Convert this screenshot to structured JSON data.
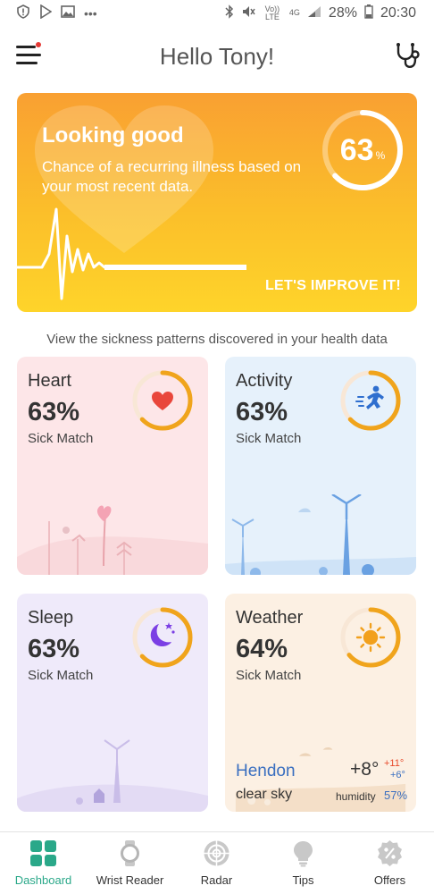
{
  "status_bar": {
    "battery": "28%",
    "time": "20:30",
    "volte_label": "Vo)) LTE",
    "network_label": "4G"
  },
  "header": {
    "title": "Hello Tony!"
  },
  "hero": {
    "title": "Looking good",
    "text": "Chance of a recurring illness based on your most recent data.",
    "percent_value": "63",
    "percent_symbol": "%",
    "progress": 0.63,
    "cta": "LET'S IMPROVE IT!"
  },
  "section_caption": "View the sickness patterns discovered in your health data",
  "cards": [
    {
      "title": "Heart",
      "percent": "63%",
      "subtitle": "Sick Match",
      "progress": 0.63,
      "icon": "heart-icon",
      "bg": "#fde6e8",
      "icon_color": "#e9463b"
    },
    {
      "title": "Activity",
      "percent": "63%",
      "subtitle": "Sick Match",
      "progress": 0.63,
      "icon": "running-icon",
      "bg": "#e6f1fb",
      "icon_color": "#2f6fcf"
    },
    {
      "title": "Sleep",
      "percent": "63%",
      "subtitle": "Sick Match",
      "progress": 0.63,
      "icon": "moon-icon",
      "bg": "#efeafa",
      "icon_color": "#7b3fe4"
    },
    {
      "title": "Weather",
      "percent": "64%",
      "subtitle": "Sick Match",
      "progress": 0.64,
      "icon": "sun-icon",
      "bg": "#fcf0e3",
      "icon_color": "#f2a01c"
    }
  ],
  "weather": {
    "city": "Hendon",
    "condition": "clear sky",
    "temp": "+8°",
    "temp_high": "+11°",
    "temp_low": "+6°",
    "humidity_label": "humidity",
    "humidity_value": "57%"
  },
  "tabs": [
    {
      "label": "Dashboard",
      "icon": "dashboard-icon",
      "active": true
    },
    {
      "label": "Wrist Reader",
      "icon": "watch-icon",
      "active": false
    },
    {
      "label": "Radar",
      "icon": "radar-icon",
      "active": false
    },
    {
      "label": "Tips",
      "icon": "lightbulb-icon",
      "active": false
    },
    {
      "label": "Offers",
      "icon": "percent-badge-icon",
      "active": false
    }
  ],
  "colors": {
    "accent": "#2aa889",
    "ring_progress": "#f0a41c",
    "hero_top": "#f9a032",
    "hero_bottom": "#fed42a"
  }
}
